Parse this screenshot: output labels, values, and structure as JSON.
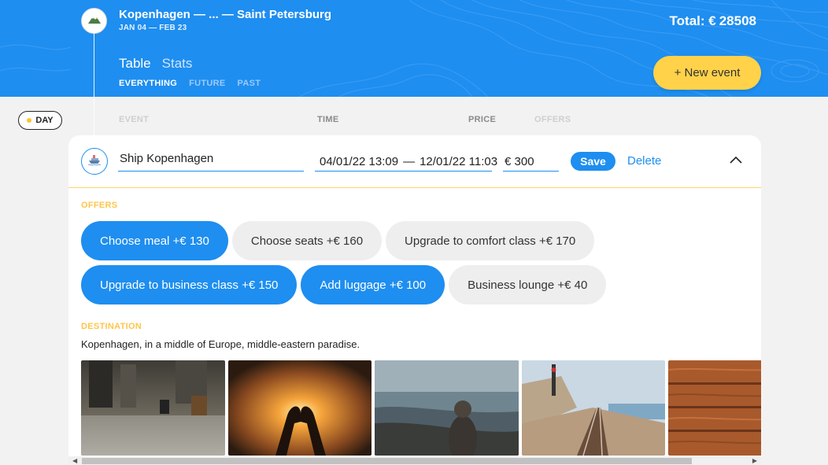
{
  "header": {
    "trip_title": "Kopenhagen — ... — Saint Petersburg",
    "trip_dates": "JAN 04 — FEB 23",
    "total_label": "Total: €",
    "total_value": "28508",
    "logo_icon": "mountain-icon",
    "view_tabs": [
      {
        "label": "Table",
        "active": true
      },
      {
        "label": "Stats",
        "active": false
      }
    ],
    "filters": [
      {
        "label": "EVERYTHING",
        "active": true
      },
      {
        "label": "FUTURE",
        "active": false
      },
      {
        "label": "PAST",
        "active": false
      }
    ],
    "new_event_label": "+ New event"
  },
  "sort": {
    "day_label": "DAY",
    "columns": [
      "EVENT",
      "TIME",
      "PRICE",
      "OFFERS"
    ]
  },
  "event_form": {
    "type_icon": "ship-icon",
    "destination": "Ship Kopenhagen",
    "time_start": "04/01/22 13:09",
    "time_separator": "—",
    "time_end": "12/01/22 11:03",
    "price": "€ 300",
    "save_label": "Save",
    "delete_label": "Delete",
    "collapse_icon": "chevron-up-icon",
    "offers_title": "OFFERS",
    "offers": [
      [
        {
          "label": "Choose meal +€  130",
          "selected": true
        },
        {
          "label": "Choose seats +€  160",
          "selected": false
        },
        {
          "label": "Upgrade to comfort class +€  170",
          "selected": false
        }
      ],
      [
        {
          "label": "Upgrade to business class +€  150",
          "selected": true
        },
        {
          "label": "Add luggage +€  100",
          "selected": true
        },
        {
          "label": "Business lounge +€  40",
          "selected": false
        }
      ]
    ],
    "destination_title": "DESTINATION",
    "destination_description": "Kopenhagen, in a middle of Europe, middle-eastern paradise.",
    "photos": [
      "subway-feet-photo",
      "heart-hands-sunset-photo",
      "hooded-person-beach-photo",
      "railway-coast-photo",
      "wood-texture-photo"
    ]
  },
  "colors": {
    "accent": "#1e8ef0",
    "yellow": "#ffd24a",
    "offer_inactive": "#eeeeee"
  }
}
